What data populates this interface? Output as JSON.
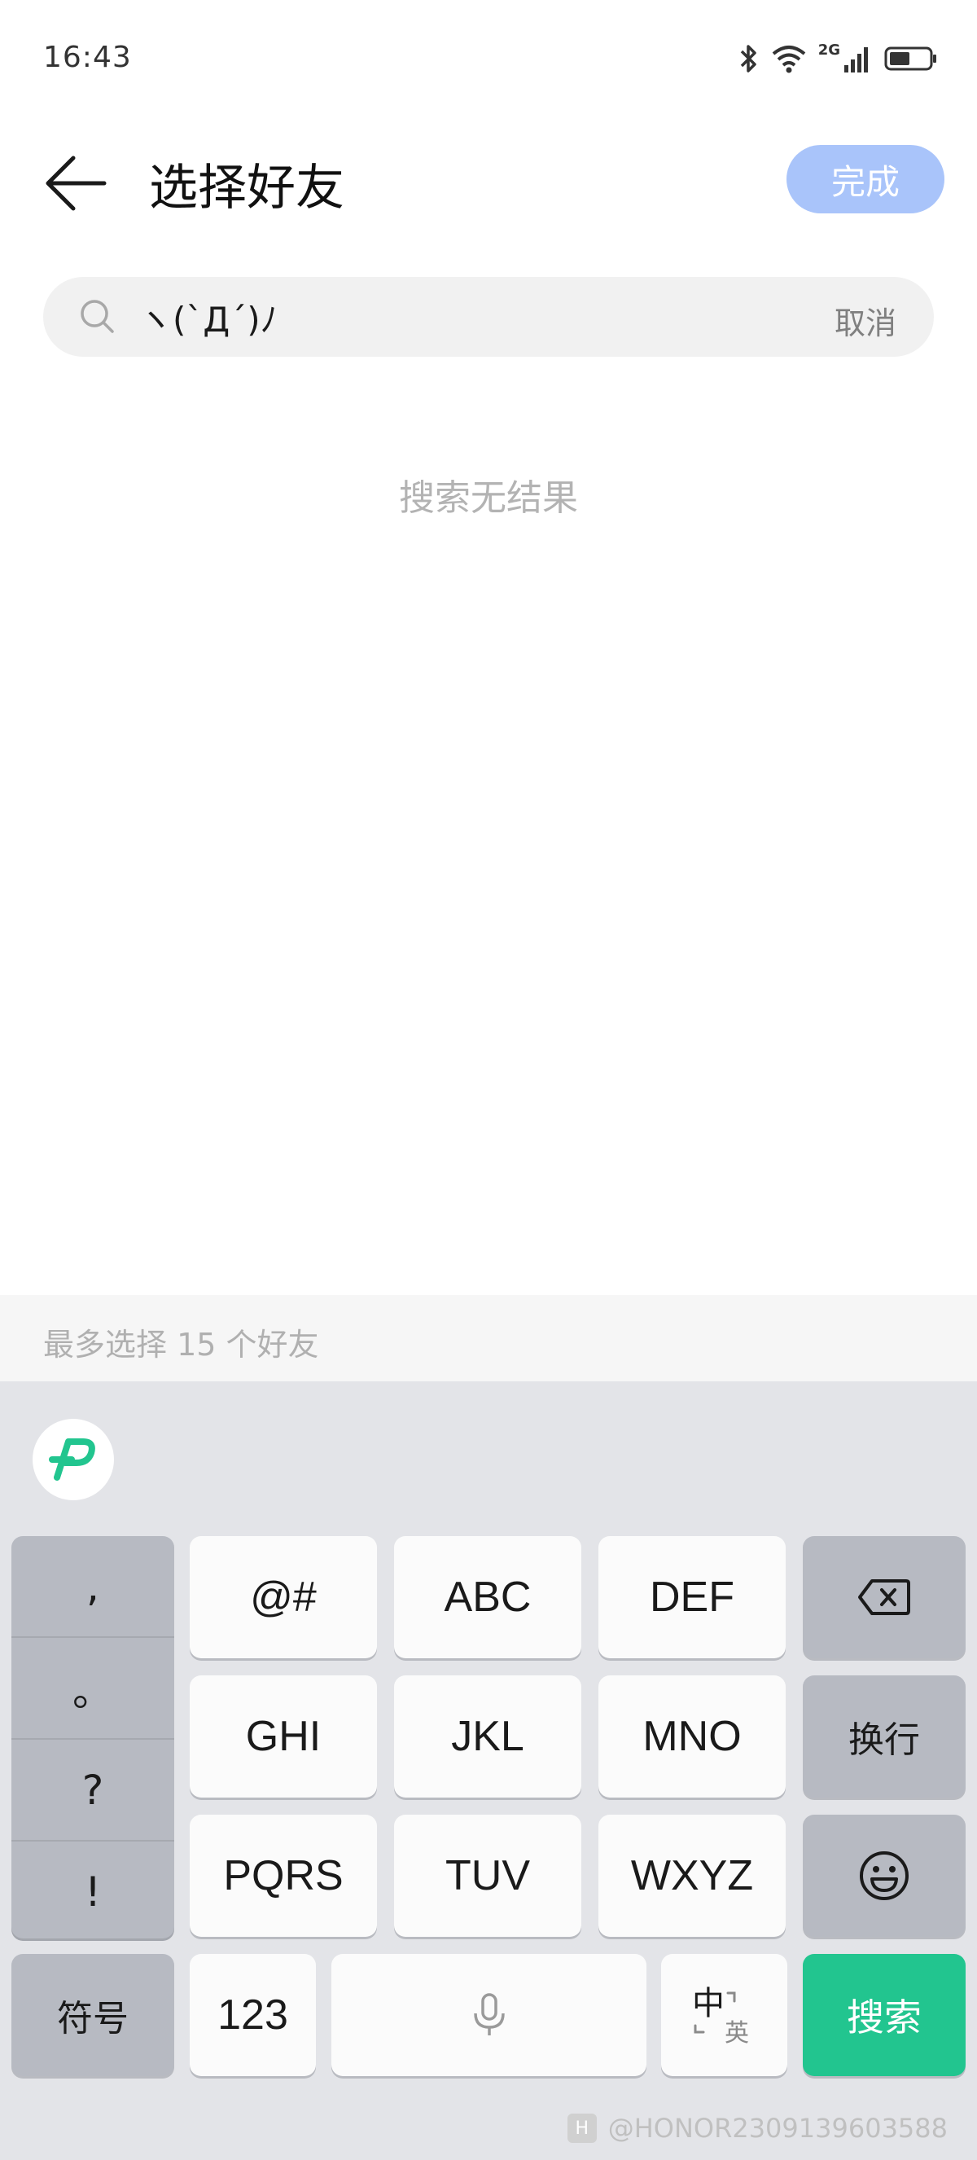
{
  "status_bar": {
    "time": "16:43",
    "network": "2G",
    "icons": [
      "bluetooth-icon",
      "wifi-icon",
      "signal-icon",
      "battery-icon"
    ]
  },
  "header": {
    "title": "选择好友",
    "done_label": "完成"
  },
  "search": {
    "value": "ヽ(`Д´)ﾉ",
    "cancel_label": "取消"
  },
  "results": {
    "empty_message": "搜索无结果"
  },
  "selection": {
    "limit_text": "最多选择 15 个好友"
  },
  "keyboard": {
    "punctuation": [
      ",",
      "。",
      "?",
      "!"
    ],
    "row1": [
      "@#",
      "ABC",
      "DEF"
    ],
    "row2": [
      "GHI",
      "JKL",
      "MNO"
    ],
    "row3": [
      "PQRS",
      "TUV",
      "WXYZ"
    ],
    "newline_label": "换行",
    "symbols_label": "符号",
    "numbers_label": "123",
    "lang_primary": "中",
    "lang_secondary": "英",
    "search_label": "搜索"
  },
  "watermark": {
    "text": "@HONOR2309139603588"
  },
  "colors": {
    "accent_blue_disabled": "#a9c4fa",
    "keyboard_green": "#22c58f",
    "keyboard_bg": "#e3e4e8"
  }
}
